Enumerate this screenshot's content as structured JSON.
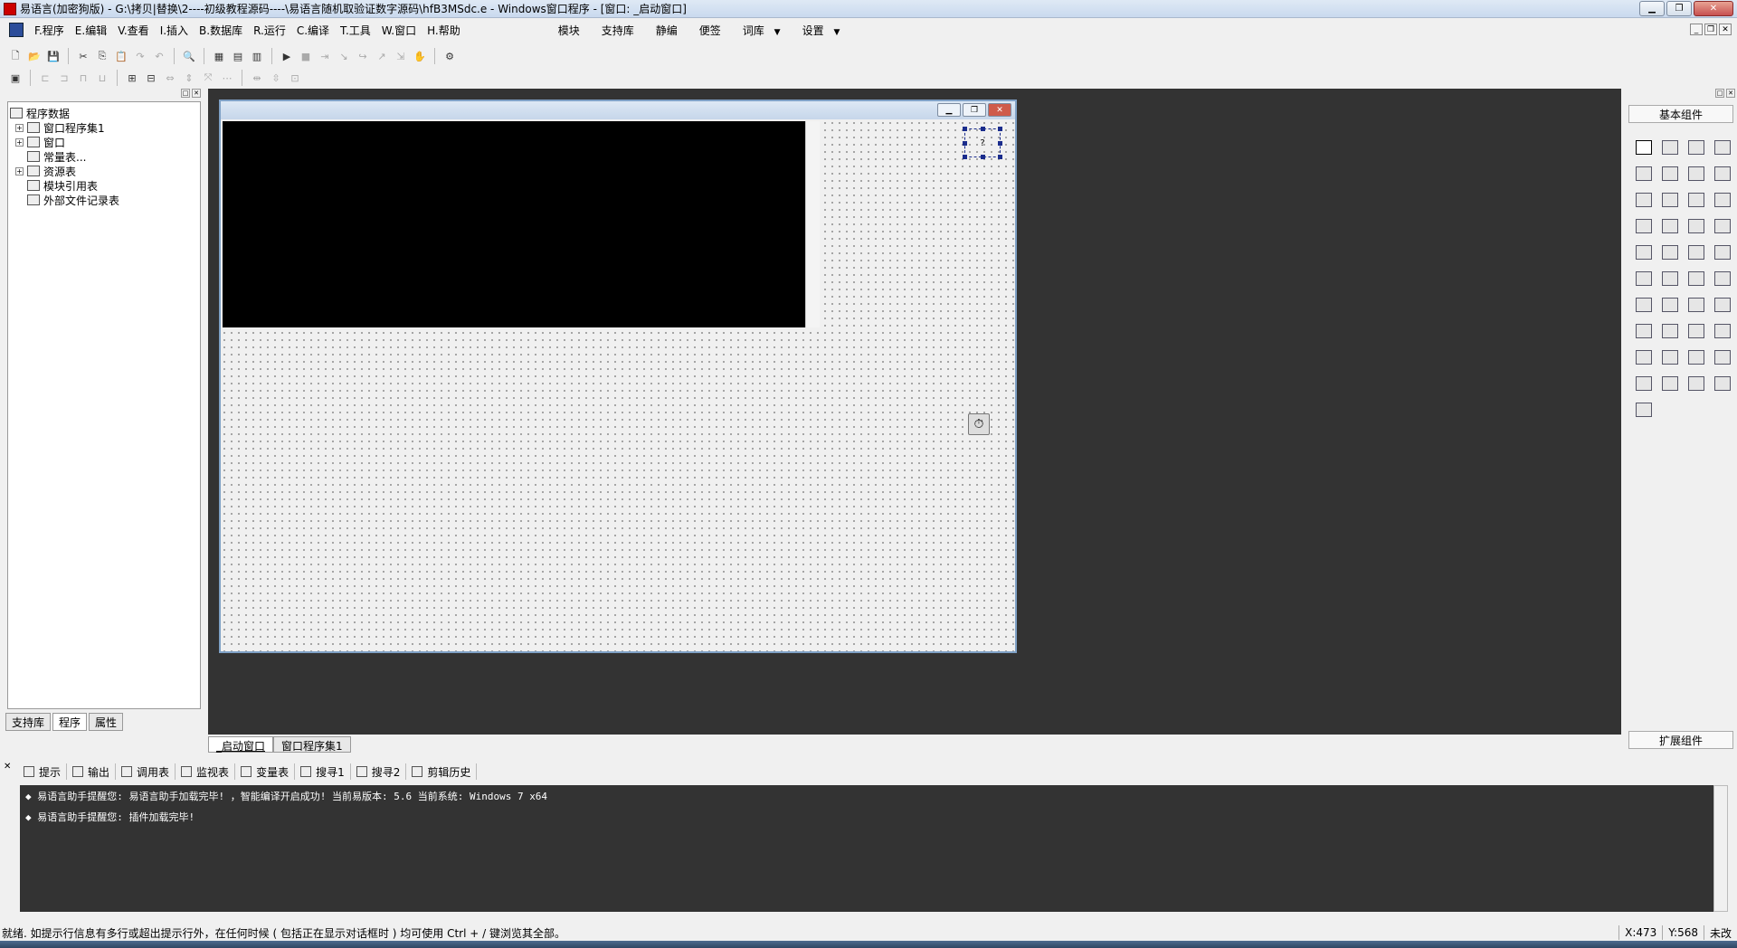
{
  "window": {
    "title": "易语言(加密狗版) - G:\\拷贝|替换\\2----初级教程源码----\\易语言随机取验证数字源码\\hfB3MSdc.e - Windows窗口程序 - [窗口: _启动窗口]"
  },
  "menu": {
    "items": [
      "F.程序",
      "E.编辑",
      "V.查看",
      "I.插入",
      "B.数据库",
      "R.运行",
      "C.编译",
      "T.工具",
      "W.窗口",
      "H.帮助"
    ],
    "right_items": [
      "模块",
      "支持库",
      "静编",
      "便签",
      "词库",
      "设置"
    ]
  },
  "tree": {
    "root": "程序数据",
    "items": [
      "窗口程序集1",
      "窗口",
      "常量表...",
      "资源表",
      "模块引用表",
      "外部文件记录表"
    ]
  },
  "left_tabs": [
    "支持库",
    "程序",
    "属性"
  ],
  "design_window": {
    "selected_control_label": "?"
  },
  "workspace_tabs": [
    "_启动窗口",
    "窗口程序集1"
  ],
  "palette": {
    "title": "基本组件",
    "footer": "扩展组件"
  },
  "output_tabs": [
    "提示",
    "输出",
    "调用表",
    "监视表",
    "变量表",
    "搜寻1",
    "搜寻2",
    "剪辑历史"
  ],
  "output_lines": [
    "易语言助手提醒您: 易语言助手加载完毕! ，智能编译开启成功! 当前易版本: 5.6 当前系统: Windows 7 x64",
    "易语言助手提醒您: 插件加载完毕!"
  ],
  "status": {
    "text": "就绪. 如提示行信息有多行或超出提示行外，在任何时候 ( 包括正在显示对话框时 ) 均可使用 Ctrl + / 键浏览其全部。",
    "x": "X:473",
    "y": "Y:568",
    "mode": "未改"
  }
}
